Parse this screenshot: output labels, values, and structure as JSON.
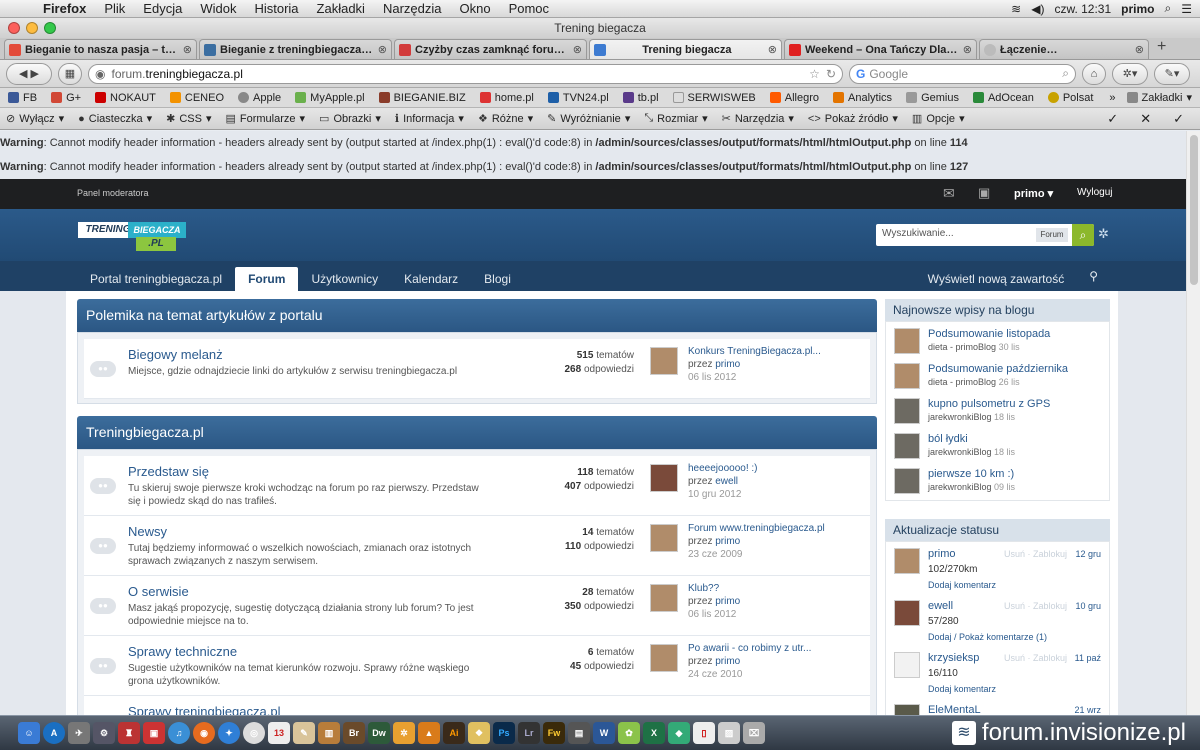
{
  "menubar": {
    "app": "Firefox",
    "menus": [
      "Plik",
      "Edycja",
      "Widok",
      "Historia",
      "Zakładki",
      "Narzędzia",
      "Okno",
      "Pomoc"
    ],
    "clock": "czw. 12:31",
    "user": "primo"
  },
  "window": {
    "title": "Trening biegacza"
  },
  "tabs": [
    {
      "label": "Bieganie to nasza pasja – tre…",
      "color": "#e34b3a"
    },
    {
      "label": "Bieganie z treningbiegacza.pl",
      "color": "#3b6ea1"
    },
    {
      "label": "Czyżby czas zamknąć forum…",
      "color": "#d23b3b"
    },
    {
      "label": "Trening biegacza",
      "color": "#3d7bd1"
    },
    {
      "label": "Weekend – Ona Tańczy Dla …",
      "color": "#e02020"
    },
    {
      "label": "Łączenie…",
      "color": "#bbbbbb"
    }
  ],
  "navbar": {
    "url_prefix": "forum.",
    "url_host": "treningbiegacza.pl",
    "search_placeholder": "Google"
  },
  "bookmarks": [
    "FB",
    "G+",
    "NOKAUT",
    "CENEO",
    "Apple",
    "MyApple.pl",
    "BIEGANIE.BIZ",
    "home.pl",
    "TVN24.pl",
    "tb.pl",
    "SERWISWEB",
    "Allegro",
    "Analytics",
    "Gemius",
    "AdOcean",
    "Polsat"
  ],
  "bookmarks_more": "Zakładki",
  "devbar": [
    "Wyłącz",
    "Ciasteczka",
    "CSS",
    "Formularze",
    "Obrazki",
    "Informacja",
    "Różne",
    "Wyróżnianie",
    "Rozmiar",
    "Narzędzia",
    "Pokaż źródło",
    "Opcje"
  ],
  "warnings": [
    {
      "label": "Warning",
      "text": ": Cannot modify header information - headers already sent by (output started at /index.php(1) : eval()'d code:8) in ",
      "file": "/admin/sources/classes/output/formats/html/htmlOutput.php",
      "online": " on line ",
      "line": "114"
    },
    {
      "label": "Warning",
      "text": ": Cannot modify header information - headers already sent by (output started at /index.php(1) : eval()'d code:8) in ",
      "file": "/admin/sources/classes/output/formats/html/htmlOutput.php",
      "online": " on line ",
      "line": "127"
    }
  ],
  "topbar": {
    "panel": "Panel moderatora",
    "user": "primo",
    "logout": "Wyloguj"
  },
  "logo": {
    "line1": "TRENING",
    "line2": "BIEGACZA",
    "line3": ".PL"
  },
  "search": {
    "placeholder": "Wyszukiwanie...",
    "scope": "Forum"
  },
  "mainnav": {
    "items": [
      "Portal treningbiegacza.pl",
      "Forum",
      "Użytkownicy",
      "Kalendarz",
      "Blogi"
    ],
    "new_content": "Wyświetl nową zawartość"
  },
  "categories": [
    {
      "title": "Polemika na temat artykułów z portalu",
      "forums": [
        {
          "title": "Biegowy melanż",
          "desc": "Miejsce, gdzie odnajdziecie linki do artykułów z serwisu treningbiegacza.pl",
          "topics": "515",
          "topics_label": "tematów",
          "replies": "268",
          "replies_label": "odpowiedzi",
          "last_title": "Konkurs TreningBiegacza.pl...",
          "by": "przez",
          "last_user": "primo",
          "date": "06 lis 2012"
        }
      ]
    },
    {
      "title": "Treningbiegacza.pl",
      "forums": [
        {
          "title": "Przedstaw się",
          "desc": "Tu skieruj swoje pierwsze kroki wchodząc na forum po raz pierwszy. Przedstaw się i powiedz skąd do nas trafiłeś.",
          "topics": "118",
          "topics_label": "tematów",
          "replies": "407",
          "replies_label": "odpowiedzi",
          "last_title": "heeeejooooo! :)",
          "by": "przez",
          "last_user": "ewell",
          "date": "10 gru 2012"
        },
        {
          "title": "Newsy",
          "desc": "Tutaj będziemy informować o wszelkich nowościach, zmianach oraz istotnych sprawach związanych z naszym serwisem.",
          "topics": "14",
          "topics_label": "tematów",
          "replies": "110",
          "replies_label": "odpowiedzi",
          "last_title": "Forum www.treningbiegacza.pl",
          "by": "przez",
          "last_user": "primo",
          "date": "23 cze 2009"
        },
        {
          "title": "O serwisie",
          "desc": "Masz jakąś propozycję, sugestię dotyczącą działania strony lub forum? To jest odpowiednie miejsce na to.",
          "topics": "28",
          "topics_label": "tematów",
          "replies": "350",
          "replies_label": "odpowiedzi",
          "last_title": "Klub??",
          "by": "przez",
          "last_user": "primo",
          "date": "06 lis 2012"
        },
        {
          "title": "Sprawy techniczne",
          "desc": "Sugestie użytkowników na temat kierunków rozwoju. Sprawy różne wąskiego grona użytkowników.",
          "topics": "6",
          "topics_label": "tematów",
          "replies": "45",
          "replies_label": "odpowiedzi",
          "last_title": "Po awarii - co robimy z utr...",
          "by": "przez",
          "last_user": "primo",
          "date": "24 cze 2010"
        },
        {
          "title": "Sprawy treningbiegacza.pl",
          "desc": "",
          "topics": "",
          "topics_label": "",
          "replies": "",
          "replies_label": "",
          "last_title": "",
          "by": "",
          "last_user": "",
          "date": ""
        }
      ]
    }
  ],
  "blog": {
    "title": "Najnowsze wpisy na blogu",
    "items": [
      {
        "title": "Podsumowanie listopada",
        "meta": "dieta - primoBlog",
        "date": "30 lis"
      },
      {
        "title": "Podsumowanie października",
        "meta": "dieta - primoBlog",
        "date": "26 lis"
      },
      {
        "title": "kupno pulsometru z GPS",
        "meta": "jarekwronkiBlog",
        "date": "18 lis"
      },
      {
        "title": "ból łydki",
        "meta": "jarekwronkiBlog",
        "date": "18 lis"
      },
      {
        "title": "pierwsze 10 km :)",
        "meta": "jarekwronkiBlog",
        "date": "09 lis"
      }
    ]
  },
  "status": {
    "title": "Aktualizacje statusu",
    "actions": "Usuń · Zablokuj",
    "items": [
      {
        "name": "primo",
        "date": "12 gru",
        "text": "102/270km",
        "comment": "Dodaj komentarz"
      },
      {
        "name": "ewell",
        "date": "10 gru",
        "text": "57/280",
        "comment": "Dodaj / Pokaż komentarze (1)"
      },
      {
        "name": "krzysieksp",
        "date": "11 paź",
        "text": "16/110",
        "comment": "Dodaj komentarz"
      },
      {
        "name": "EleMentaL",
        "date": "21 wrz",
        "text": "",
        "comment": ""
      }
    ]
  },
  "dock": {
    "brand": "forum.invisionize.pl"
  }
}
